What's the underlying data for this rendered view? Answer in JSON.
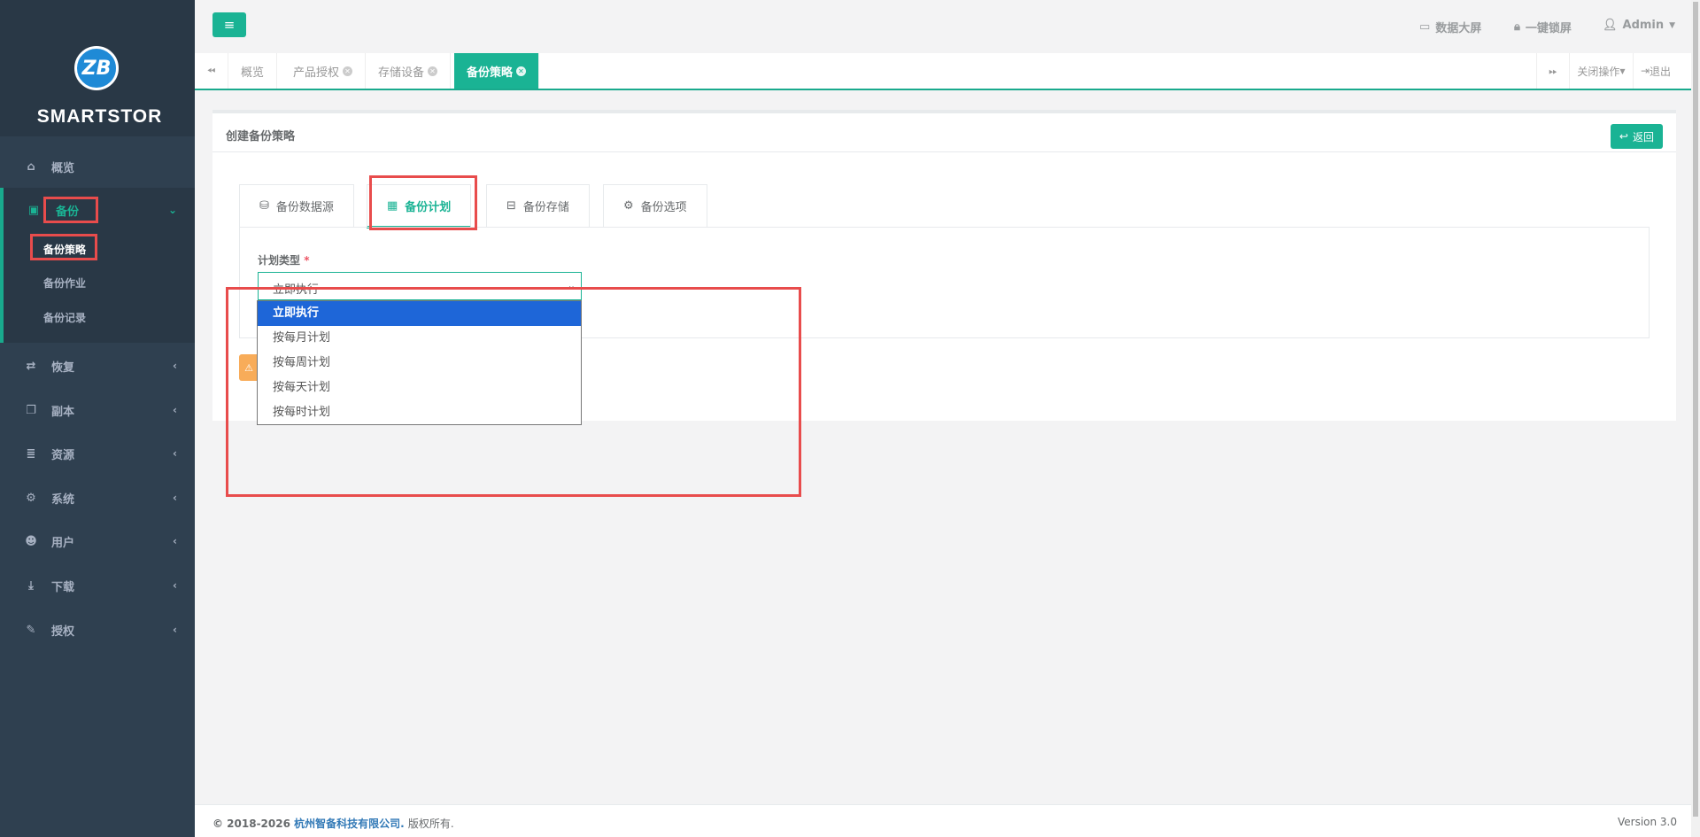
{
  "brand": {
    "logo_letter": "ZB",
    "name": "SMARTSTOR"
  },
  "sidebar": {
    "items": [
      {
        "label": "概览",
        "icon": "home-icon"
      },
      {
        "label": "备份",
        "icon": "cube-icon"
      },
      {
        "label": "恢复",
        "icon": "retweet-icon"
      },
      {
        "label": "副本",
        "icon": "copy-icon"
      },
      {
        "label": "资源",
        "icon": "server-icon"
      },
      {
        "label": "系统",
        "icon": "cogs-icon"
      },
      {
        "label": "用户",
        "icon": "users-icon"
      },
      {
        "label": "下载",
        "icon": "download-icon"
      },
      {
        "label": "授权",
        "icon": "edit-icon"
      }
    ],
    "backup_sub": [
      "备份策略",
      "备份作业",
      "备份记录"
    ]
  },
  "topbar": {
    "big_screen": "数据大屏",
    "lock": "一键锁屏",
    "user": "Admin"
  },
  "page_tabs": [
    "概览",
    "产品授权",
    "存储设备",
    "备份策略"
  ],
  "tab_actions": {
    "close_ops": "关闭操作",
    "logout": "退出"
  },
  "panel": {
    "title": "创建备份策略",
    "back": "返回",
    "tabs": [
      "备份数据源",
      "备份计划",
      "备份存储",
      "备份选项"
    ],
    "field_label": "计划类型",
    "required_mark": "*",
    "select_value": "立即执行",
    "options": [
      "立即执行",
      "按每月计划",
      "按每周计划",
      "按每天计划",
      "按每时计划"
    ]
  },
  "footer": {
    "copyright": "© 2018-2026",
    "company": "杭州智备科技有限公司.",
    "rights": "版权所有.",
    "version": "Version 3.0"
  },
  "colors": {
    "sidebar": "#2f4050",
    "accent": "#1ab394",
    "highlight": "#e84c4c",
    "selected_option": "#1e66d8"
  }
}
